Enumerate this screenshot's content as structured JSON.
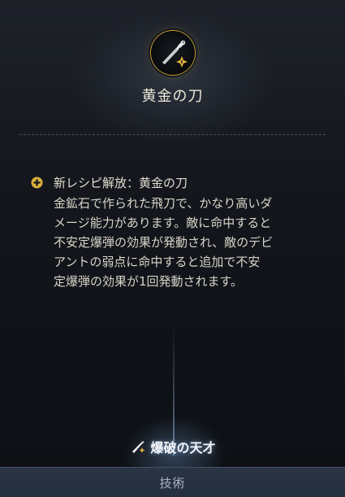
{
  "header": {
    "title": "黄金の刀",
    "icon": "golden-knife-icon"
  },
  "recipe": {
    "unlock_text": "新レシピ解放：黄金の刀",
    "description": "金鉱石で作られた飛刀で、かなり高いダ\nメージ能力があります。敵に命中すると\n不安定爆弾の効果が発動され、敵のデビ\nアントの弱点に命中すると追加で不安\n定爆弾の効果が1回発動されます。",
    "icon": "plus-icon"
  },
  "skill": {
    "name": "爆破の天才",
    "icon": "knife-spark-icon"
  },
  "footer": {
    "label": "技術"
  },
  "colors": {
    "accent_gold": "#d9b13b",
    "background": "#14171d",
    "footer_bg": "#2a3442"
  }
}
